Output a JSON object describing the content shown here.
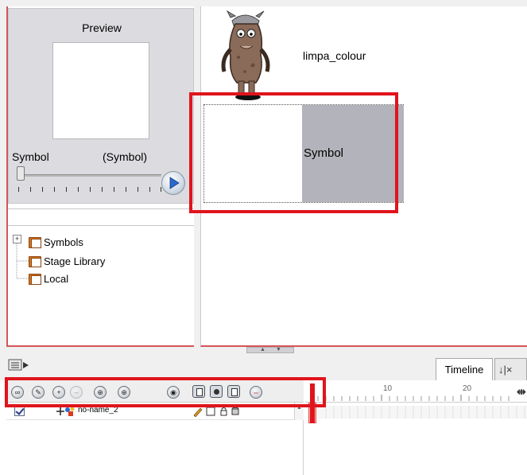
{
  "library": {
    "preview_title": "Preview",
    "symbol_label": "Symbol",
    "symbol_type": "(Symbol)",
    "tree_items": [
      {
        "label": "Symbols"
      },
      {
        "label": "Stage Library"
      },
      {
        "label": "Local"
      }
    ]
  },
  "stage": {
    "character_name": "limpa_colour",
    "symbol_name": "Symbol"
  },
  "timeline": {
    "tabs": [
      {
        "label": "Timeline"
      },
      {
        "label": "↓|×"
      }
    ],
    "ruler_numbers": [
      "10",
      "20"
    ],
    "layers": [
      {
        "name": "no-name_2",
        "visible": true
      }
    ]
  },
  "colors": {
    "highlight": "#e0141c",
    "playhead": "#e0141c",
    "symbol_fill": "#b3b3bb"
  }
}
